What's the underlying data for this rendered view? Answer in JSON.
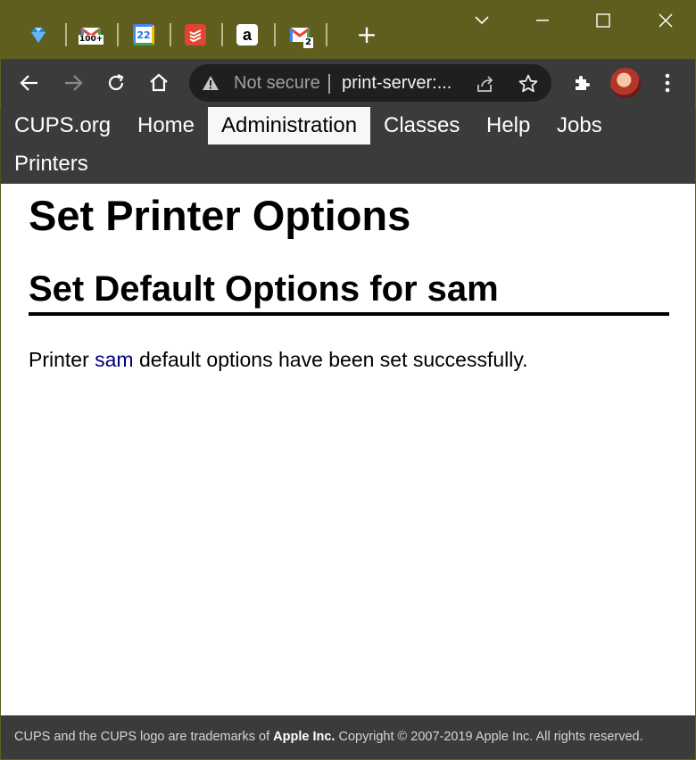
{
  "tabs": [
    {
      "name": "tab-gem",
      "favicon": "gem-icon",
      "badge": ""
    },
    {
      "name": "tab-gmail-100",
      "favicon": "gmail-icon",
      "badge": "100+"
    },
    {
      "name": "tab-calendar",
      "favicon": "calendar-icon",
      "badge": "22"
    },
    {
      "name": "tab-todoist",
      "favicon": "todoist-icon",
      "badge": ""
    },
    {
      "name": "tab-amazon",
      "favicon": "amazon-icon",
      "badge": "a"
    },
    {
      "name": "tab-gmail-2",
      "favicon": "gmail-icon",
      "badge": "2"
    }
  ],
  "newtab_label": "+",
  "omnibox": {
    "security_label": "Not secure",
    "url": "print-server:..."
  },
  "nav": {
    "items": [
      {
        "label": "CUPS.org"
      },
      {
        "label": "Home"
      },
      {
        "label": "Administration"
      },
      {
        "label": "Classes"
      },
      {
        "label": "Help"
      },
      {
        "label": "Jobs"
      },
      {
        "label": "Printers"
      }
    ],
    "active": "Administration"
  },
  "page": {
    "title": "Set Printer Options",
    "subtitle": "Set Default Options for sam",
    "message_prefix": "Printer",
    "printer_link": "sam",
    "message_suffix": "default options have been set successfully."
  },
  "footer": {
    "text_prefix": "CUPS and the CUPS logo are trademarks of",
    "company": "Apple Inc.",
    "text_suffix": "Copyright © 2007-2019 Apple Inc. All rights reserved."
  },
  "colors": {
    "frame": "#5f5e1f",
    "toolbar": "#3b3b3b",
    "link": "#000080"
  }
}
